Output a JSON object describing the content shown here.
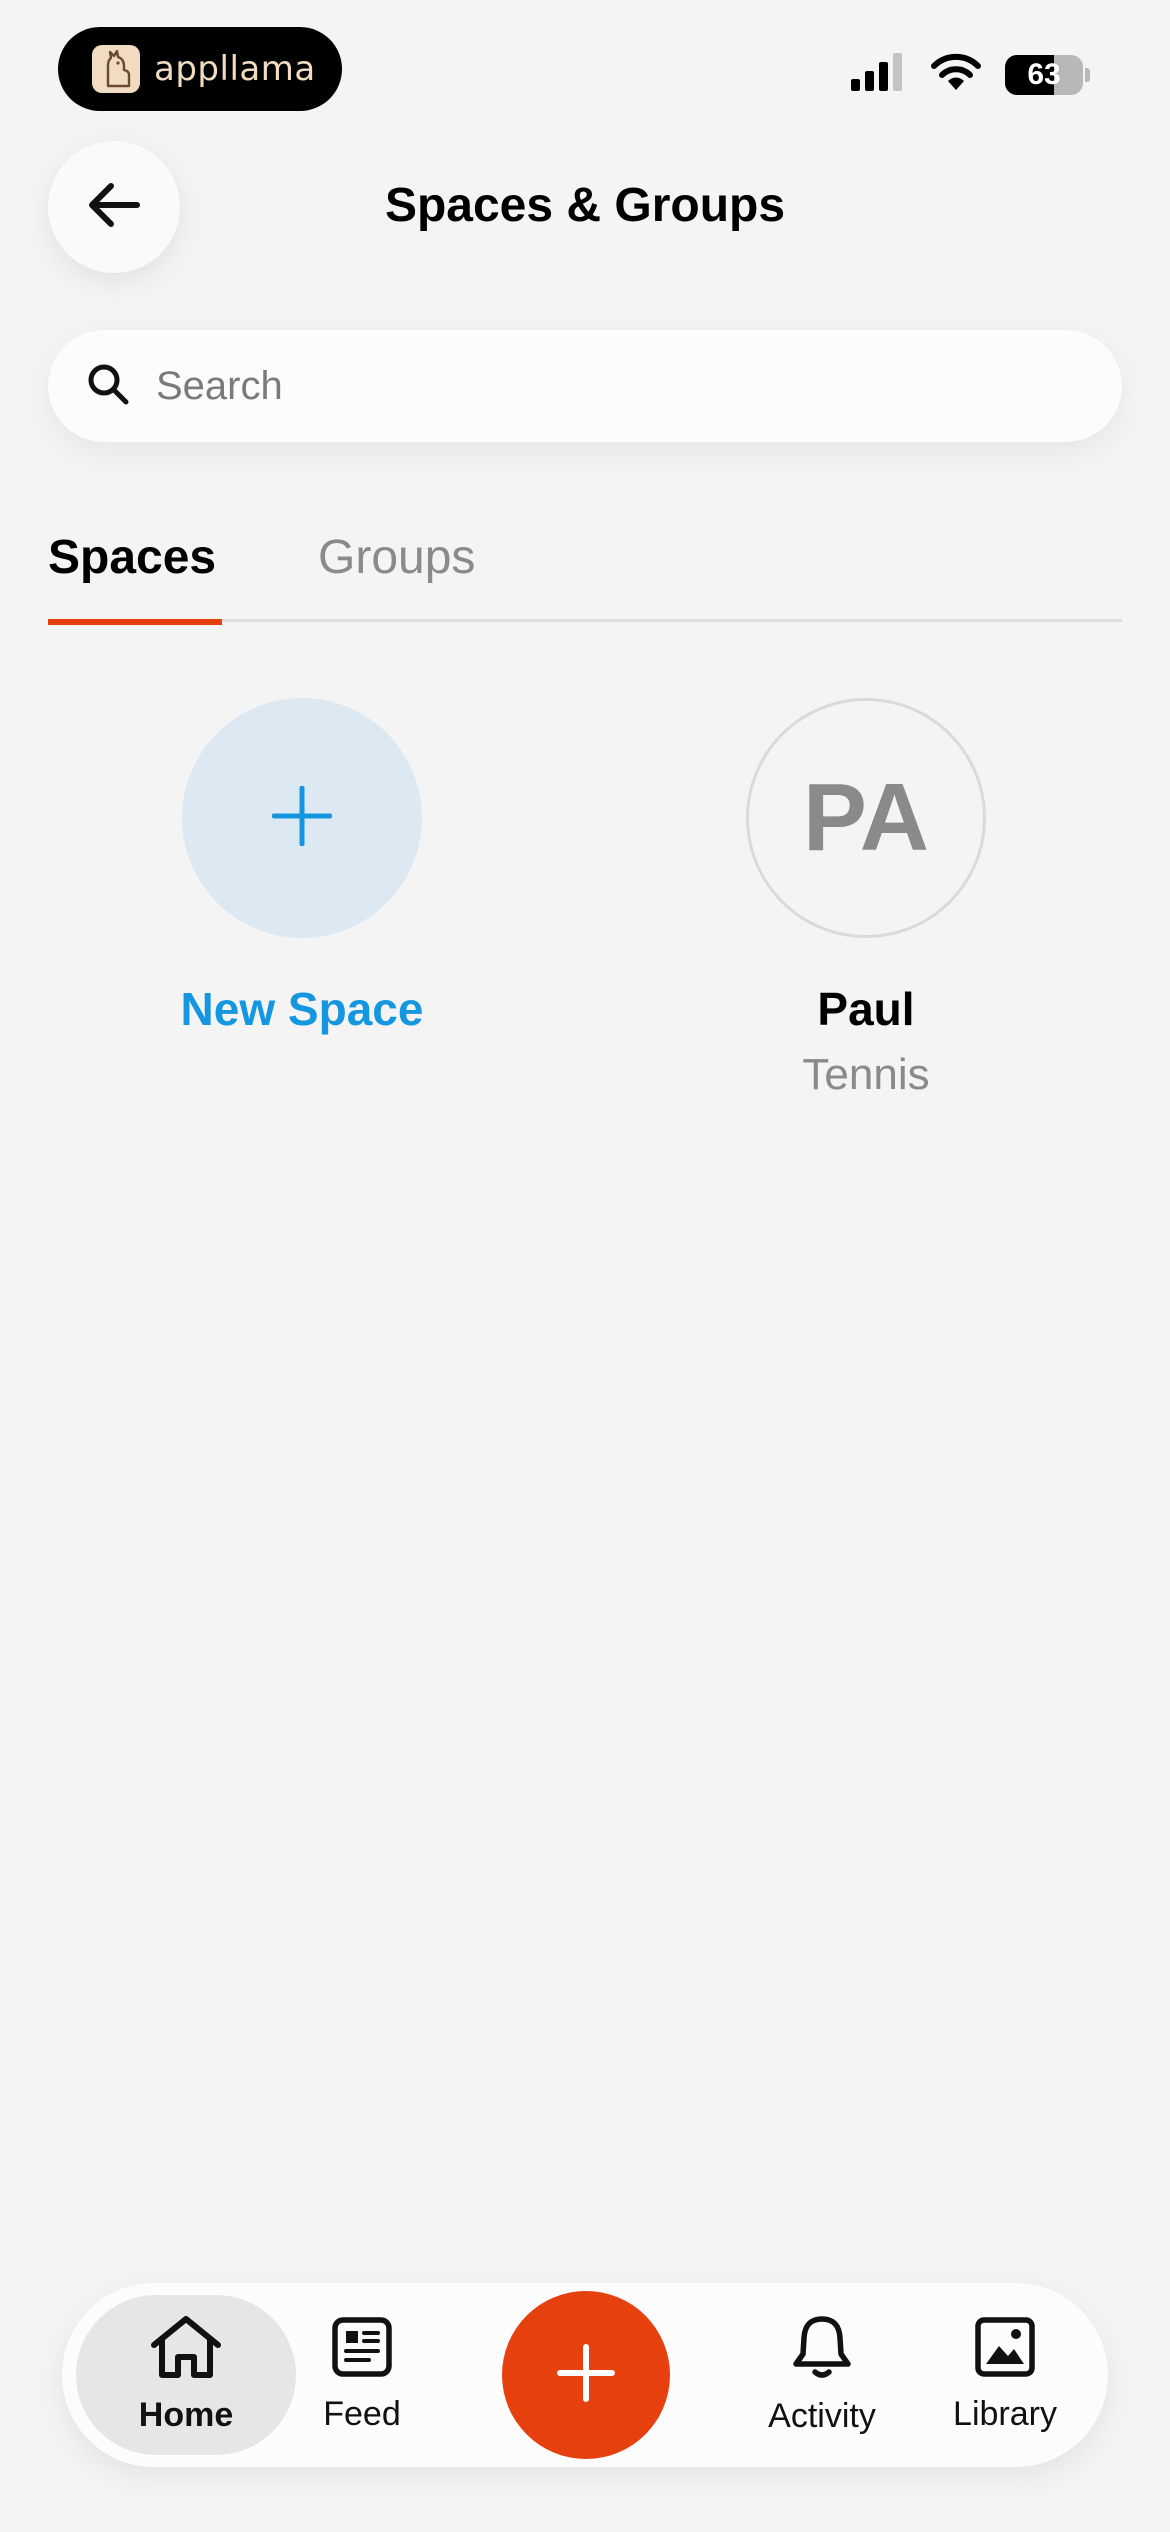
{
  "status_bar": {
    "app_badge": "appllama",
    "battery": "63",
    "battery_level": 0.63,
    "icons": [
      "signal-icon",
      "wifi-icon",
      "battery-icon"
    ]
  },
  "header": {
    "title": "Spaces & Groups",
    "back_icon": "arrow-left-icon"
  },
  "search": {
    "placeholder": "Search",
    "value": "",
    "icon": "search-icon"
  },
  "tabs": [
    {
      "label": "Spaces",
      "active": true
    },
    {
      "label": "Groups",
      "active": false
    }
  ],
  "spaces": {
    "new": {
      "label": "New Space",
      "icon": "plus-icon"
    },
    "items": [
      {
        "initials": "PA",
        "name": "Paul",
        "subtitle": "Tennis"
      }
    ]
  },
  "bottom_nav": {
    "items": [
      {
        "label": "Home",
        "icon": "home-icon",
        "active": true
      },
      {
        "label": "Feed",
        "icon": "feed-icon",
        "active": false
      },
      {
        "label": "Activity",
        "icon": "bell-icon",
        "active": false
      },
      {
        "label": "Library",
        "icon": "image-icon",
        "active": false
      }
    ],
    "fab_icon": "plus-icon"
  },
  "colors": {
    "accent": "#e5400d",
    "link_blue": "#1496e0",
    "background": "#f4f4f4",
    "badge_tan": "#f1dcc2"
  }
}
